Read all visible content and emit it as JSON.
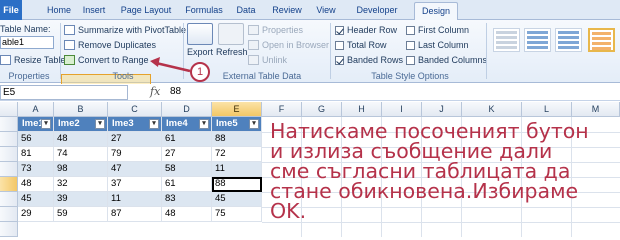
{
  "tabs": [
    "File",
    "Home",
    "Insert",
    "Page Layout",
    "Formulas",
    "Data",
    "Review",
    "View",
    "Developer",
    "Design"
  ],
  "properties": {
    "label": "Table Name:",
    "name_value": "able1",
    "resize": "Resize Table",
    "group": "Properties"
  },
  "tools": {
    "summarize": "Summarize with PivotTable",
    "remove_dup": "Remove Duplicates",
    "convert": "Convert to Range",
    "group": "Tools"
  },
  "external": {
    "export": "Export",
    "refresh": "Refresh",
    "properties": "Properties",
    "open_browser": "Open in Browser",
    "unlink": "Unlink",
    "group": "External Table Data"
  },
  "style_options": {
    "header_row": "Header Row",
    "total_row": "Total Row",
    "banded_rows": "Banded Rows",
    "first_column": "First Column",
    "last_column": "Last Column",
    "banded_columns": "Banded Columns",
    "group": "Table Style Options"
  },
  "formula_bar": {
    "cell": "E5",
    "fx": "fx",
    "value": "88"
  },
  "columns": [
    "A",
    "B",
    "C",
    "D",
    "E",
    "F",
    "G",
    "H",
    "I",
    "J",
    "K",
    "L",
    "M"
  ],
  "table": {
    "headers": [
      "Ime1",
      "Ime2",
      "Ime3",
      "Ime4",
      "Ime5"
    ],
    "rows": [
      [
        "56",
        "48",
        "27",
        "61",
        "88"
      ],
      [
        "81",
        "74",
        "79",
        "27",
        "72"
      ],
      [
        "73",
        "98",
        "47",
        "58",
        "11"
      ],
      [
        "48",
        "32",
        "37",
        "61",
        "88"
      ],
      [
        "45",
        "39",
        "11",
        "83",
        "45"
      ],
      [
        "29",
        "59",
        "87",
        "48",
        "75"
      ]
    ]
  },
  "annotation": {
    "badge": "1",
    "lines": [
      "Натискаме посоченият бутон",
      "и излиза съобщение дали",
      "сме съгласни таблицата да",
      "стане обикновена.Избираме OK."
    ]
  },
  "colors": {
    "header_blue": "#4f81bd",
    "band_blue": "#dce6f1",
    "note_red": "#b5324a"
  }
}
